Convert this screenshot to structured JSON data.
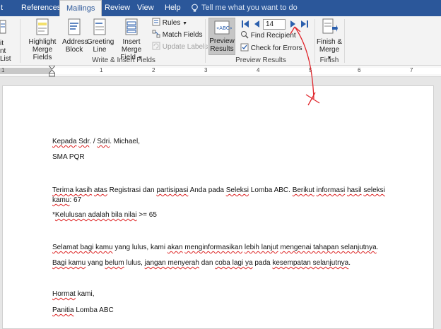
{
  "tabs": [
    "t",
    "References",
    "Mailings",
    "Review",
    "View",
    "Help"
  ],
  "tell_me": "Tell me what you want to do",
  "ribbon": {
    "left_cut_1": "it",
    "left_cut_2": "nt List",
    "highlight_1": "Highlight",
    "highlight_2": "Merge Fields",
    "address_1": "Address",
    "address_2": "Block",
    "greeting_1": "Greeting",
    "greeting_2": "Line",
    "insert_1": "Insert Merge",
    "insert_2": "Field",
    "rules": "Rules",
    "match": "Match Fields",
    "update": "Update Labels",
    "group_write": "Write & Insert Fields",
    "preview_1": "Preview",
    "preview_2": "Results",
    "record": "14",
    "find": "Find Recipient",
    "check": "Check for Errors",
    "group_preview": "Preview Results",
    "finish_1": "Finish &",
    "finish_2": "Merge",
    "group_finish": "Finish"
  },
  "ruler_numbers": [
    "1",
    "1",
    "2",
    "3",
    "4",
    "5",
    "6",
    "7"
  ],
  "doc": {
    "line1": {
      "a": "Kepada",
      "b": " ",
      "c": "Sdr",
      "d": ". / ",
      "e": "Sdri",
      "f": ". Michael,"
    },
    "line2": "SMA PQR",
    "p3": {
      "a": "Terima kasih",
      "b": " ",
      "c": "atas",
      "d": " Registrasi dan ",
      "e": "partisipasi",
      "f": " Anda pada ",
      "g": "Seleksi",
      "h": " Lomba ABC. ",
      "i": "Berikut",
      "j": " ",
      "k": "informasi",
      "l": " ",
      "m": "hasil",
      "n": " ",
      "o": "seleksi",
      "p": "kamu",
      "q": ": 67"
    },
    "p4": {
      "a": "*",
      "b": "Kelulusan adalah bila nilai",
      "c": " >= 65"
    },
    "p5": {
      "a": "Selamat bagi kamu",
      "b": " yang lulus, kami ",
      "c": "akan",
      "d": " ",
      "e": "menginformasikan",
      "f": " ",
      "g": "lebih lanjut",
      "h": " ",
      "i": "mengenai tahapan selanjutnya",
      "j": "."
    },
    "p6": {
      "a": "Bagi kamu",
      "b": " yang ",
      "c": "belum",
      "d": " lulus, ",
      "e": "jangan menyerah",
      "f": " dan ",
      "g": "coba lagi ya",
      "h": " pada ",
      "i": "kesempatan selanjutnya",
      "j": "."
    },
    "p7": {
      "a": "Hormat",
      "b": " kami,"
    },
    "p8": {
      "a": "Panitia",
      "b": " Lomba ABC"
    }
  },
  "colors": {
    "tabbar": "#2b579a",
    "ribbon": "#f3f3f3",
    "annotation": "#e0242a",
    "nav_arrow": "#2b5fad"
  }
}
